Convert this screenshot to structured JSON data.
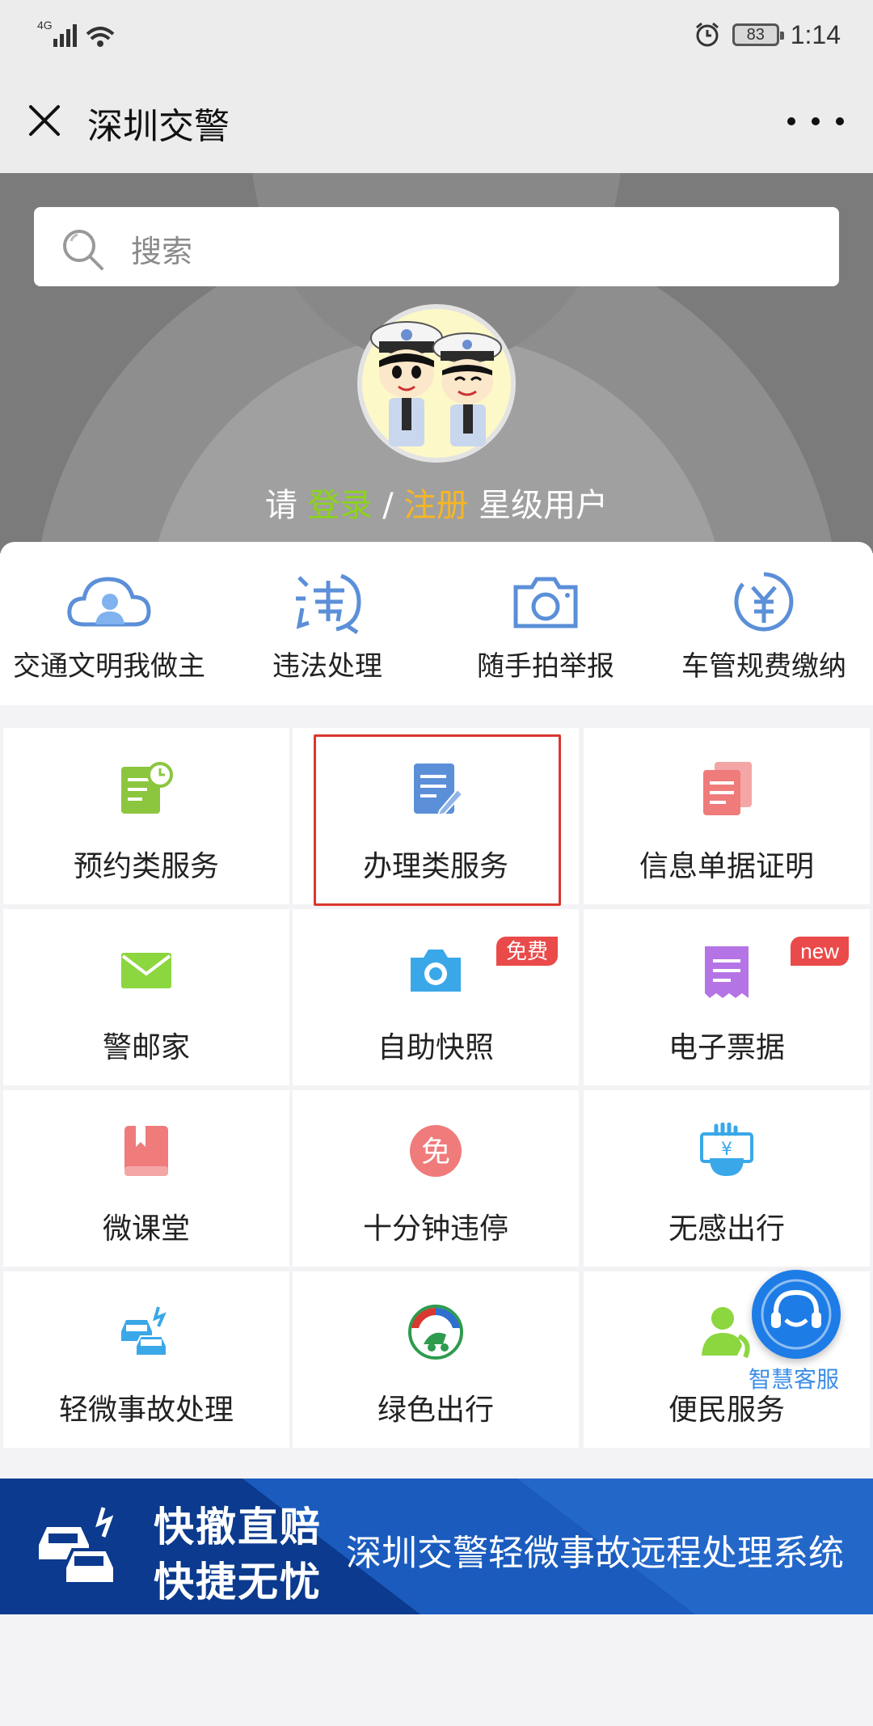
{
  "status_bar": {
    "network": "4G",
    "battery": "83",
    "time": "1:14"
  },
  "nav": {
    "title": "深圳交警"
  },
  "search": {
    "placeholder": "搜索"
  },
  "login": {
    "prefix": "请",
    "login_link": "登录",
    "separator": "/",
    "register_link": "注册",
    "suffix": "星级用户"
  },
  "quick_services": [
    {
      "label": "交通文明我做主",
      "icon": "cloud-user-icon"
    },
    {
      "label": "违法处理",
      "icon": "violation-icon"
    },
    {
      "label": "随手拍举报",
      "icon": "camera-icon"
    },
    {
      "label": "车管规费缴纳",
      "icon": "yuan-icon"
    }
  ],
  "grid": [
    {
      "label": "预约类服务",
      "icon": "appointment-icon",
      "color": "#8cc63f"
    },
    {
      "label": "办理类服务",
      "icon": "document-edit-icon",
      "color": "#5b8fd8",
      "selected": true
    },
    {
      "label": "信息单据证明",
      "icon": "documents-icon",
      "color": "#ef7b7b"
    },
    {
      "label": "警邮家",
      "icon": "mail-icon",
      "color": "#8cd63f"
    },
    {
      "label": "自助快照",
      "icon": "camera-icon",
      "color": "#3aa8e8",
      "badge": "免费"
    },
    {
      "label": "电子票据",
      "icon": "receipt-icon",
      "color": "#b574e6",
      "badge": "new"
    },
    {
      "label": "微课堂",
      "icon": "book-icon",
      "color": "#ef7b7b"
    },
    {
      "label": "十分钟违停",
      "icon": "free-parking-icon",
      "color": "#ef7b7b",
      "glyph": "免"
    },
    {
      "label": "无感出行",
      "icon": "hand-payment-icon",
      "color": "#3aa8e8"
    },
    {
      "label": "轻微事故处理",
      "icon": "car-accident-icon",
      "color": "#3aa8e8"
    },
    {
      "label": "绿色出行",
      "icon": "green-travel-icon",
      "color": "#2e9b4e"
    },
    {
      "label": "便民服务",
      "icon": "phone-person-icon",
      "color": "#8cd63f"
    }
  ],
  "floating": {
    "label": "智慧客服"
  },
  "banner": {
    "line1": "快撤直赔",
    "line2": "快捷无忧",
    "system": "深圳交警轻微事故远程处理系统"
  }
}
